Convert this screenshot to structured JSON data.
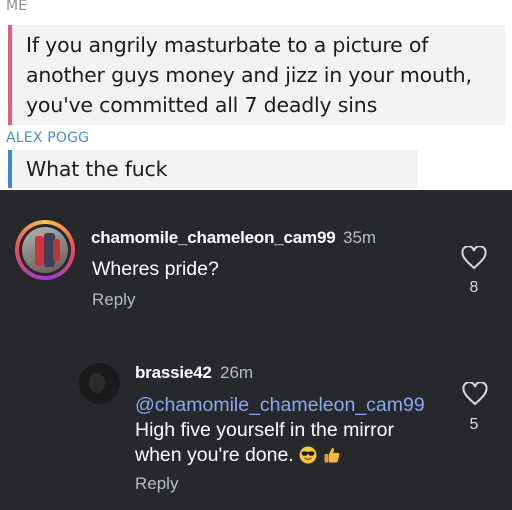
{
  "chat": {
    "messages": [
      {
        "sender": "ME",
        "lines": [
          "If you angrily masturbate to a picture of",
          "another guys money and jizz in your mouth,",
          "you've committed all 7 deadly sins"
        ]
      },
      {
        "sender": "ALEX POGG",
        "lines": [
          "What the fuck"
        ]
      }
    ]
  },
  "comments": [
    {
      "username": "chamomile_chameleon_cam99",
      "time": "35m",
      "text_lines": [
        "Wheres pride?"
      ],
      "reply_label": "Reply",
      "likes": "8"
    },
    {
      "username": "brassie42",
      "time": "26m",
      "mention": "@chamomile_chameleon_cam99",
      "text_lines": [
        "High five yourself in the mirror",
        "when you're done."
      ],
      "emojis": [
        "sunglasses-face",
        "thumbs-up"
      ],
      "reply_label": "Reply",
      "likes": "5"
    }
  ],
  "colors": {
    "me_bar": "#ec5a7b",
    "other_bar": "#3d8ad1",
    "other_sender": "#4a8ec9",
    "mention": "#8da8f5",
    "comments_bg": "#26282b"
  }
}
